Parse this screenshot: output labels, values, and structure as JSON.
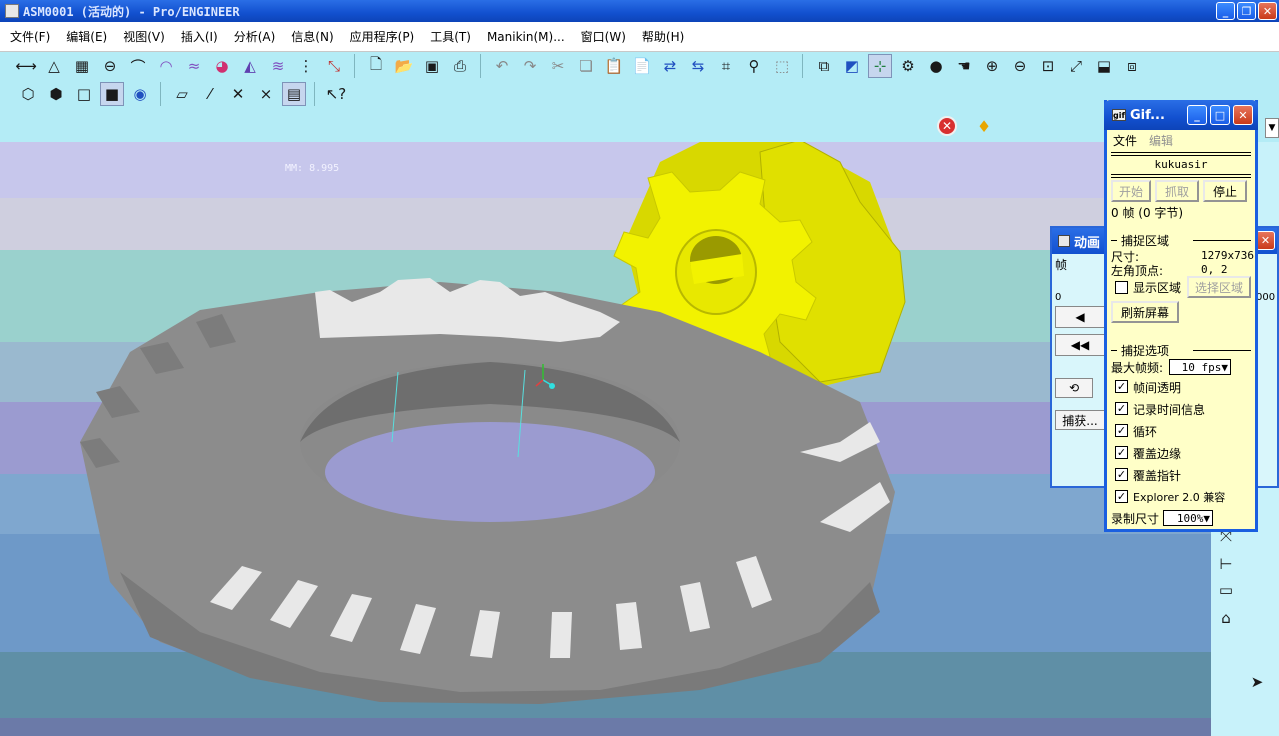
{
  "window": {
    "title": "ASM0001 (活动的) - Pro/ENGINEER",
    "controls": [
      "minimize",
      "restore",
      "close"
    ]
  },
  "menu": [
    "文件(F)",
    "编辑(E)",
    "视图(V)",
    "插入(I)",
    "分析(A)",
    "信息(N)",
    "应用程序(P)",
    "工具(T)",
    "Manikin(M)...",
    "窗口(W)",
    "帮助(H)"
  ],
  "toolbar": {
    "row1_icons": [
      "dimension-icon",
      "datum-plane-icon",
      "datum-axis-icon",
      "datum-point-icon",
      "coord-sys-icon",
      "curvature-icon",
      "offset-icon",
      "surface-analysis-icon",
      "draft-icon",
      "shade-icon",
      "graph-icon",
      "deviation-icon",
      "new-file-icon",
      "open-file-icon",
      "save-icon",
      "print-icon",
      "undo-icon",
      "redo-icon",
      "cut-icon",
      "copy-icon",
      "paste-icon",
      "paste-special-icon",
      "regenerate-icon",
      "regen-manager-icon",
      "find-icon",
      "select-box-icon",
      "model-tree-icon",
      "layers-icon",
      "component-display-icon",
      "spin-center-icon",
      "orient-icon",
      "saved-views-icon",
      "pan-icon",
      "zoom-in-icon",
      "zoom-out-icon",
      "refit-icon",
      "reorient-icon",
      "view-manager-icon",
      "layer-tree-icon"
    ],
    "row2_icons": [
      "wireframe-icon",
      "hidden-line-icon",
      "no-hidden-icon",
      "shading-icon",
      "enhanced-realism-icon",
      "datum-planes-toggle-icon",
      "datum-axes-toggle-icon",
      "point-symbols-toggle-icon",
      "csys-toggle-icon",
      "annotations-toggle-icon",
      "context-help-icon"
    ]
  },
  "canvas": {
    "readout": "MM: 8.995",
    "band_colors": [
      "#c7c7ec",
      "#cfcfdf",
      "#9ad1cd",
      "#9ab9cf",
      "#9b9bd0",
      "#7fa7cf",
      "#6e99c8",
      "#5f8fa6",
      "#6b7aa8"
    ],
    "gear_colors": {
      "ring": "#8c8c8c",
      "ring_light": "#e8e8e8",
      "pinion": "#f0f000"
    }
  },
  "anim_panel": {
    "title": "动画",
    "frame_label": "帧",
    "slider_start": "0",
    "slider_end": "000",
    "capture_button": "捕获..."
  },
  "gif_capture": {
    "title": "Gif...",
    "menu": [
      "文件",
      "编辑"
    ],
    "user": "kukuasir",
    "buttons": {
      "start": "开始",
      "grab": "抓取",
      "stop": "停止"
    },
    "status": "0 帧 (0 字节)",
    "capture_area": {
      "heading": "捕捉区域",
      "size_label": "尺寸:",
      "size_value": "1279x736",
      "corner_label": "左角顶点:",
      "corner_value": "0, 2",
      "show_area": "显示区域",
      "show_area_checked": false,
      "select_area_button": "选择区域",
      "refresh_button": "刷新屏幕"
    },
    "capture_options": {
      "heading": "捕捉选项",
      "max_fps_label": "最大帧频:",
      "max_fps_value": "10 fps",
      "options": [
        {
          "label": "帧间透明",
          "checked": true
        },
        {
          "label": "记录时间信息",
          "checked": true
        },
        {
          "label": "循环",
          "checked": true
        },
        {
          "label": "覆盖边缘",
          "checked": true
        },
        {
          "label": "覆盖指针",
          "checked": true
        },
        {
          "label": "Explorer 2.0 兼容",
          "checked": true
        }
      ],
      "record_size_label": "录制尺寸",
      "record_size_value": "100%"
    }
  }
}
